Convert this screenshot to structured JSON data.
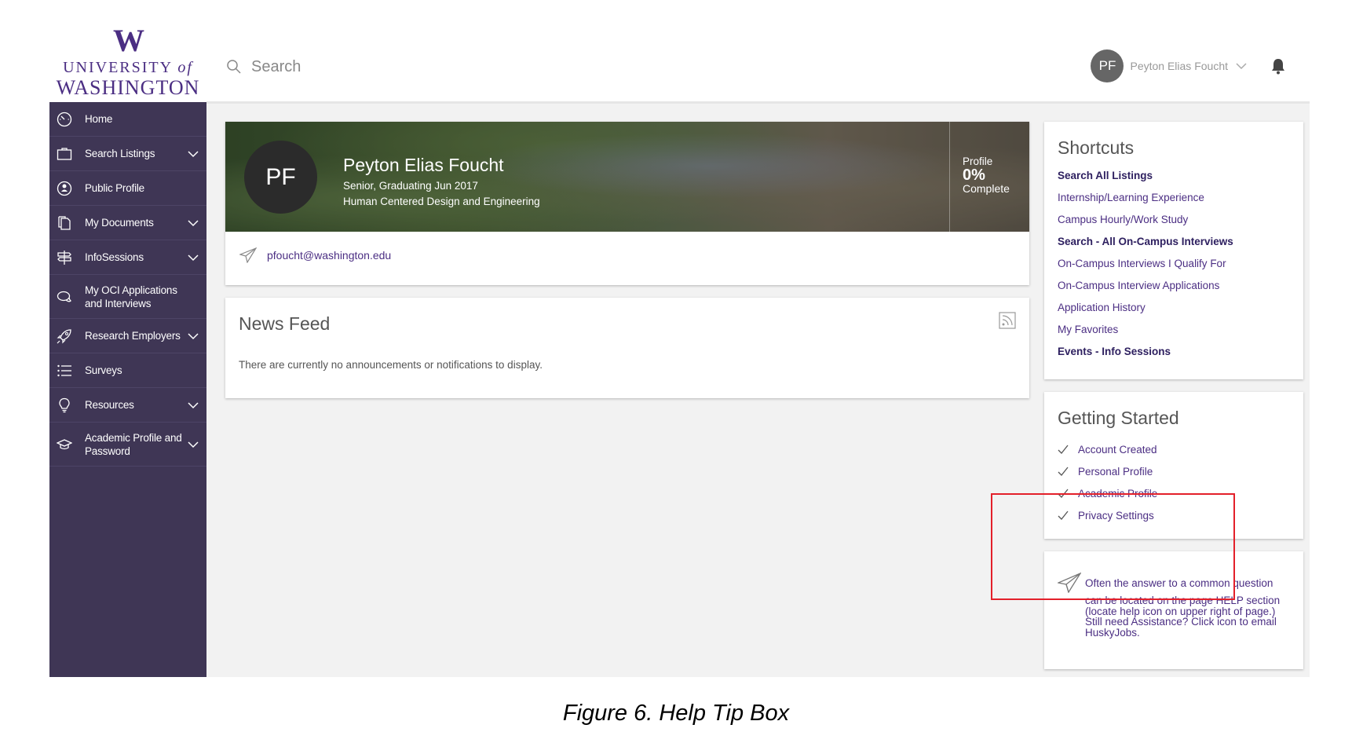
{
  "logo": {
    "mark": "W",
    "line1": "UNIVERSITY",
    "line1_of": "of",
    "line2": "WASHINGTON"
  },
  "search": {
    "placeholder": "Search",
    "icon": "search-icon"
  },
  "user": {
    "initials": "PF",
    "name": "Peyton Elias Foucht",
    "menu_icon": "chevron-down-icon",
    "notification_icon": "bell-icon"
  },
  "sidebar": {
    "items": [
      {
        "label": "Home",
        "icon": "dashboard-icon",
        "expandable": false
      },
      {
        "label": "Search Listings",
        "icon": "briefcase-icon",
        "expandable": true
      },
      {
        "label": "Public Profile",
        "icon": "profile-icon",
        "expandable": false
      },
      {
        "label": "My Documents",
        "icon": "documents-icon",
        "expandable": true
      },
      {
        "label": "InfoSessions",
        "icon": "signpost-icon",
        "expandable": true
      },
      {
        "label": "My OCI Applications and Interviews",
        "icon": "chat-bubbles-icon",
        "expandable": false
      },
      {
        "label": "Research Employers",
        "icon": "rocket-icon",
        "expandable": true
      },
      {
        "label": "Surveys",
        "icon": "list-icon",
        "expandable": false
      },
      {
        "label": "Resources",
        "icon": "lightbulb-icon",
        "expandable": true
      },
      {
        "label": "Academic Profile and Password",
        "icon": "graduation-cap-icon",
        "expandable": true
      }
    ]
  },
  "profile": {
    "initials": "PF",
    "name": "Peyton Elias Foucht",
    "status": "Senior, Graduating Jun 2017",
    "program": "Human Centered Design and Engineering",
    "completion_label": "Profile",
    "completion_value": "0%",
    "completion_suffix": "Complete",
    "completion_percent": 0,
    "email": "pfoucht@washington.edu"
  },
  "news_feed": {
    "title": "News Feed",
    "empty_message": "There are currently no announcements or notifications to display.",
    "icon": "rss-icon"
  },
  "shortcuts": {
    "title": "Shortcuts",
    "items": [
      {
        "label": "Search All Listings",
        "bold": true
      },
      {
        "label": "Internship/Learning Experience",
        "bold": false
      },
      {
        "label": "Campus Hourly/Work Study",
        "bold": false
      },
      {
        "label": "Search - All On-Campus Interviews",
        "bold": true
      },
      {
        "label": "On-Campus Interviews I Qualify For",
        "bold": false
      },
      {
        "label": "On-Campus Interview Applications",
        "bold": false
      },
      {
        "label": "Application History",
        "bold": false
      },
      {
        "label": "My Favorites",
        "bold": false
      },
      {
        "label": "Events - Info Sessions",
        "bold": true
      }
    ]
  },
  "getting_started": {
    "title": "Getting Started",
    "items": [
      {
        "label": "Account Created",
        "done": true
      },
      {
        "label": "Personal Profile",
        "done": true
      },
      {
        "label": "Academic Profile",
        "done": true
      },
      {
        "label": "Privacy Settings",
        "done": true
      }
    ]
  },
  "help_tip": {
    "line1": "Often the answer to a common question",
    "rest": "can be located on the page HELP section (locate help icon on upper right of page.) Still need Assistance? Click icon to email HuskyJobs.",
    "icon": "paper-plane-icon"
  },
  "caption": "Figure 6. Help Tip Box",
  "colors": {
    "brand_purple": "#4b2e83",
    "sidebar_bg": "#3f3655",
    "highlight_red": "#e3202a"
  }
}
